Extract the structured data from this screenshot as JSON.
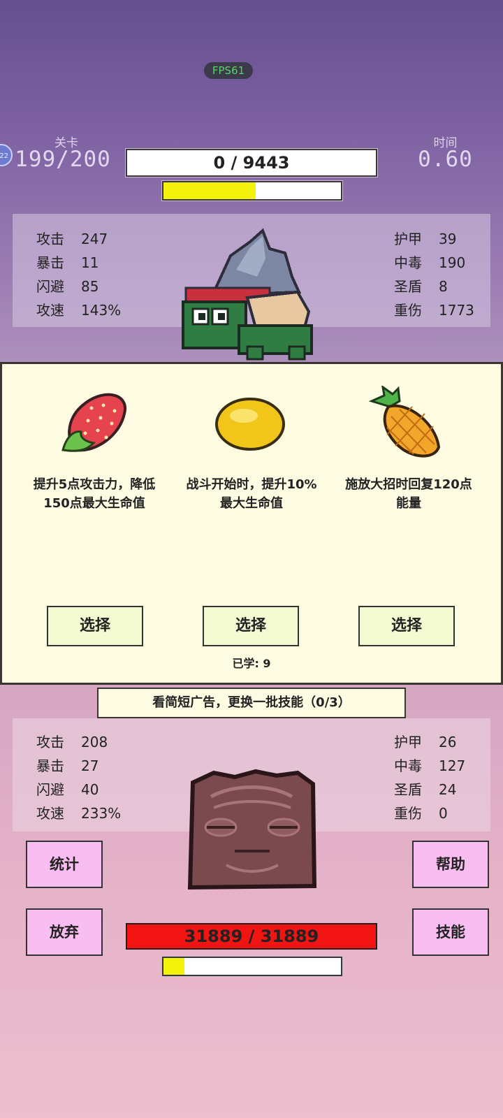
{
  "fps": "FPS61",
  "badge": "22",
  "header": {
    "level_label": "关卡",
    "level_value": "199/200",
    "time_label": "时间",
    "time_value": "0.60"
  },
  "enemy": {
    "hp_text": "0 / 9443",
    "energy_fraction": 0.52,
    "stats_left": [
      {
        "label": "攻击",
        "value": "247"
      },
      {
        "label": "暴击",
        "value": "11"
      },
      {
        "label": "闪避",
        "value": "85"
      },
      {
        "label": "攻速",
        "value": "143%"
      }
    ],
    "stats_right": [
      {
        "label": "护甲",
        "value": "39"
      },
      {
        "label": "中毒",
        "value": "190"
      },
      {
        "label": "圣盾",
        "value": "8"
      },
      {
        "label": "重伤",
        "value": "1773"
      }
    ]
  },
  "skills": [
    {
      "icon": "strawberry-icon",
      "desc": "提升5点攻击力，降低150点最大生命值",
      "button": "选择"
    },
    {
      "icon": "lemon-icon",
      "desc": "战斗开始时，提升10%最大生命值",
      "button": "选择"
    },
    {
      "icon": "pineapple-icon",
      "desc": "施放大招时回复120点能量",
      "button": "选择"
    }
  ],
  "learned": "已学: 9",
  "ad_refresh": "看简短广告，更换一批技能（0/3）",
  "player": {
    "hp_text": "31889 / 31889",
    "energy_fraction": 0.12,
    "stats_left": [
      {
        "label": "攻击",
        "value": "208"
      },
      {
        "label": "暴击",
        "value": "27"
      },
      {
        "label": "闪避",
        "value": "40"
      },
      {
        "label": "攻速",
        "value": "233%"
      }
    ],
    "stats_right": [
      {
        "label": "护甲",
        "value": "26"
      },
      {
        "label": "中毒",
        "value": "127"
      },
      {
        "label": "圣盾",
        "value": "24"
      },
      {
        "label": "重伤",
        "value": "0"
      }
    ]
  },
  "buttons": {
    "stats": "统计",
    "help": "帮助",
    "give_up": "放弃",
    "skills": "技能"
  },
  "colors": {
    "energy_yellow": "#f3f20a",
    "hp_red": "#f21313",
    "button_pink": "#f8bdf1",
    "select_green": "#f4fbd2",
    "card_cream": "#fdfce2"
  }
}
